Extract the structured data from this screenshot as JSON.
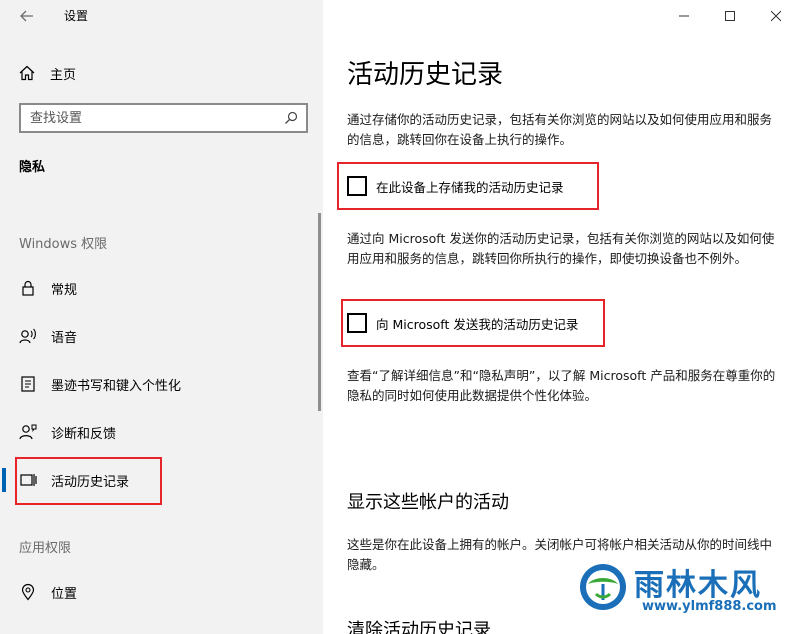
{
  "window": {
    "title": "设置",
    "controls": {
      "minimize": "—",
      "maximize": "☐",
      "close": "✕"
    }
  },
  "nav": {
    "home_label": "主页",
    "search": {
      "placeholder": "查找设置"
    },
    "section_label": "隐私",
    "windows_permissions_header": "Windows 权限",
    "items": [
      {
        "label": "常规",
        "icon": "lock-icon"
      },
      {
        "label": "语音",
        "icon": "speech-icon"
      },
      {
        "label": "墨迹书写和键入个性化",
        "icon": "ink-typing-icon"
      },
      {
        "label": "诊断和反馈",
        "icon": "feedback-icon"
      },
      {
        "label": "活动历史记录",
        "icon": "activity-history-icon",
        "active": true
      }
    ],
    "app_permissions_header": "应用权限",
    "app_items": [
      {
        "label": "位置",
        "icon": "location-icon"
      }
    ]
  },
  "main": {
    "title": "活动历史记录",
    "intro": "通过存储你的活动历史记录，包括有关你浏览的网站以及如何使用应用和服务的信息，跳转回你在设备上执行的操作。",
    "store_checkbox": {
      "label": "在此设备上存储我的活动历史记录",
      "checked": false
    },
    "send_intro": "通过向 Microsoft 发送你的活动历史记录，包括有关你浏览的网站以及如何使用应用和服务的信息，跳转回你所执行的操作，即使切换设备也不例外。",
    "send_checkbox": {
      "label": "向 Microsoft 发送我的活动历史记录",
      "checked": false
    },
    "privacy_text": "查看“了解详细信息”和“隐私声明”，以了解 Microsoft 产品和服务在尊重你的隐私的同时如何使用此数据提供个性化体验。",
    "accounts_title": "显示这些帐户的活动",
    "accounts_text": "这些是你在此设备上拥有的帐户。关闭帐户可将帐户相关活动从你的时间线中隐藏。",
    "clear_title": "清除活动历史记录"
  },
  "watermark": {
    "title": "雨林木风",
    "url": "www.ylmf888.com"
  },
  "colors": {
    "accent": "#0063b1",
    "highlight": "#e8242b",
    "watermark": "#1a6fb8"
  }
}
